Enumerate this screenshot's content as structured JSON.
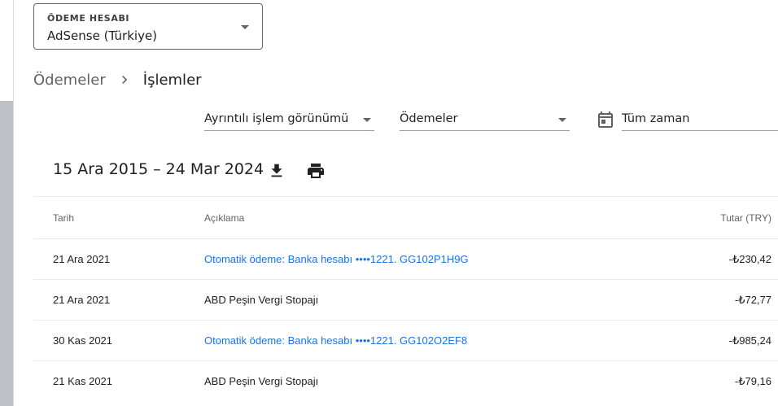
{
  "account": {
    "label": "ÖDEME HESABI",
    "value": "AdSense (Türkiye)"
  },
  "breadcrumb": {
    "parent": "Ödemeler",
    "current": "İşlemler"
  },
  "filters": {
    "view": "Ayrıntılı işlem görünümü",
    "type": "Ödemeler",
    "date": "Tüm zaman"
  },
  "range": {
    "title": "15 Ara 2015 – 24 Mar 2024"
  },
  "table": {
    "headers": {
      "date": "Tarih",
      "description": "Açıklama",
      "amount": "Tutar (TRY)"
    },
    "rows": [
      {
        "date": "21 Ara 2021",
        "description": "Otomatik ödeme: Banka hesabı  ••••1221. GG102P1H9G",
        "amount": "-₺230,42"
      },
      {
        "date": "21 Ara 2021",
        "description": "ABD Peşin Vergi Stopajı",
        "amount": "-₺72,77"
      },
      {
        "date": "30 Kas 2021",
        "description": "Otomatik ödeme: Banka hesabı  ••••1221. GG102O2EF8",
        "amount": "-₺985,24"
      },
      {
        "date": "21 Kas 2021",
        "description": "ABD Peşin Vergi Stopajı",
        "amount": "-₺79,16"
      }
    ]
  },
  "colors": {
    "link": "#1a73e8",
    "text": "#202124",
    "muted": "#5f6368",
    "divider": "#e8eaed"
  },
  "icons": {
    "filter_caret": "arrow-drop-down-icon",
    "breadcrumb_separator": "chevron-right-icon",
    "date_picker": "calendar-icon",
    "download": "download-icon",
    "print": "print-icon"
  }
}
